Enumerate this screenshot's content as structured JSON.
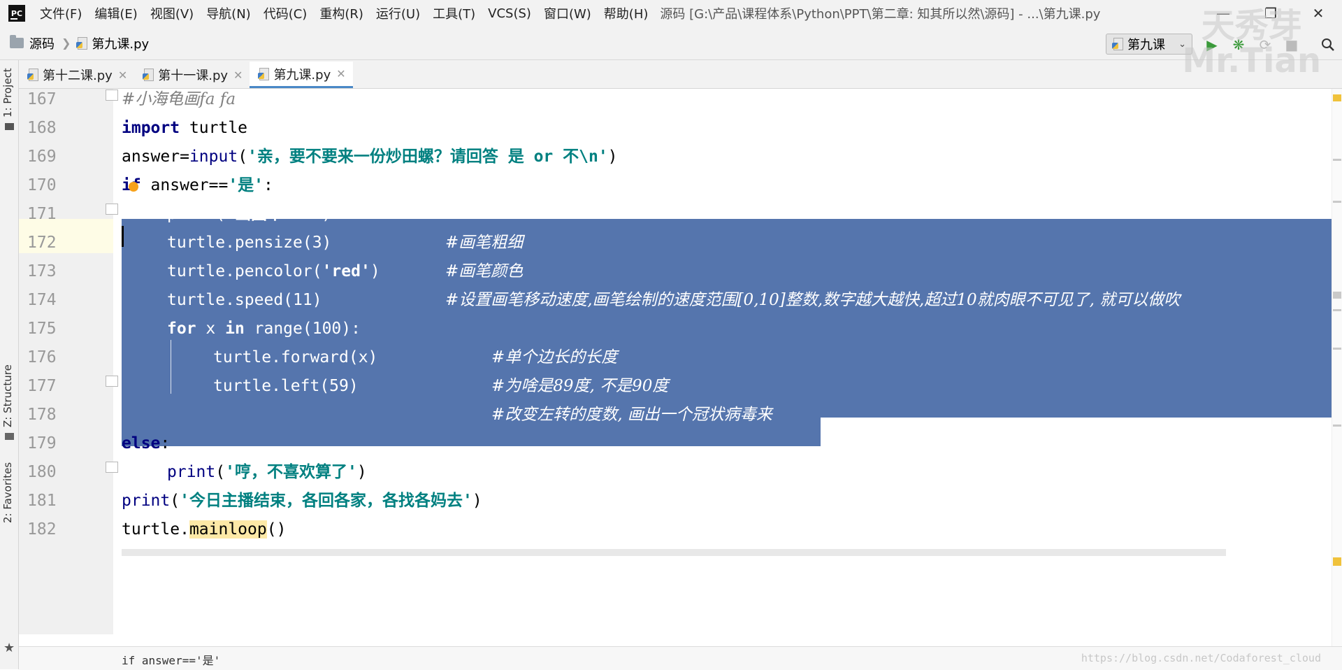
{
  "titlebar": {
    "menu": [
      "文件(F)",
      "编辑(E)",
      "视图(V)",
      "导航(N)",
      "代码(C)",
      "重构(R)",
      "运行(U)",
      "工具(T)",
      "VCS(S)",
      "窗口(W)",
      "帮助(H)"
    ],
    "window_title": "源码 [G:\\产品\\课程体系\\Python\\PPT\\第二章: 知其所以然\\源码] - ...\\第九课.py",
    "app_logo": "PC"
  },
  "toolbar": {
    "crumb_root": "源码",
    "crumb_file": "第九课.py",
    "run_config": "第九课"
  },
  "left_panel": {
    "project": "1: Project",
    "structure": "Z: Structure",
    "favorites": "2: Favorites"
  },
  "tabs": [
    {
      "label": "第十二课.py",
      "active": false
    },
    {
      "label": "第十一课.py",
      "active": false
    },
    {
      "label": "第九课.py",
      "active": true
    }
  ],
  "editor": {
    "line_numbers": [
      "167",
      "168",
      "169",
      "170",
      "171",
      "172",
      "173",
      "174",
      "175",
      "176",
      "177",
      "178",
      "179",
      "180",
      "181",
      "182"
    ],
    "lines": {
      "l167": "#小海龟画fa fa",
      "l168_kw": "import",
      "l168_rest": " turtle",
      "l169_a": "answer=",
      "l169_fn": "input",
      "l169_b": "(",
      "l169_str": "'亲，要不要来一份炒田螺？请回答 是 or 不\\n'",
      "l169_c": ")",
      "l170_kw": "if",
      "l170_a": " answer==",
      "l170_str": "'是'",
      "l170_b": ":",
      "l171_a": "print(",
      "l171_str": "'画图中...'",
      "l171_b": ")",
      "l172_code": "turtle.pensize(3)",
      "l172_cmt": "#画笔粗细",
      "l173_a": "turtle.pencolor(",
      "l173_str": "'red'",
      "l173_b": ")",
      "l173_cmt": "#画笔颜色",
      "l174_code": "turtle.speed(11)",
      "l174_cmt": "#设置画笔移动速度,画笔绘制的速度范围[0,10]整数,数字越大越快,超过10就肉眼不可见了, 就可以做吹",
      "l175_kw1": "for",
      "l175_a": " x ",
      "l175_kw2": "in",
      "l175_b": " range(100):",
      "l176_code": "turtle.forward(x)",
      "l176_cmt": "#单个边长的长度",
      "l177_code": "turtle.left(59)",
      "l177_cmt": "#为啥是89度, 不是90度",
      "l178_cmt": "#改变左转的度数, 画出一个冠状病毒来",
      "l179_kw": "else",
      "l179_b": ":",
      "l180_fn": "print",
      "l180_a": "(",
      "l180_str": "'哼，不喜欢算了'",
      "l180_b": ")",
      "l181_fn": "print",
      "l181_a": "(",
      "l181_str": "'今日主播结束，各回各家，各找各妈去'",
      "l181_b": ")",
      "l182_a": "turtle.",
      "l182_hl": "mainloop",
      "l182_b": "()"
    },
    "breadcrumb": "if answer=='是'"
  },
  "watermark": {
    "logo_line1": "天秀芽",
    "logo_line2": "Mr.Tian",
    "url": "https://blog.csdn.net/Codaforest_cloud"
  },
  "colors": {
    "selection": "#5575ad",
    "keyword": "#000080",
    "string": "#008080",
    "comment": "#808080",
    "tab_active_underline": "#4a88c7"
  }
}
